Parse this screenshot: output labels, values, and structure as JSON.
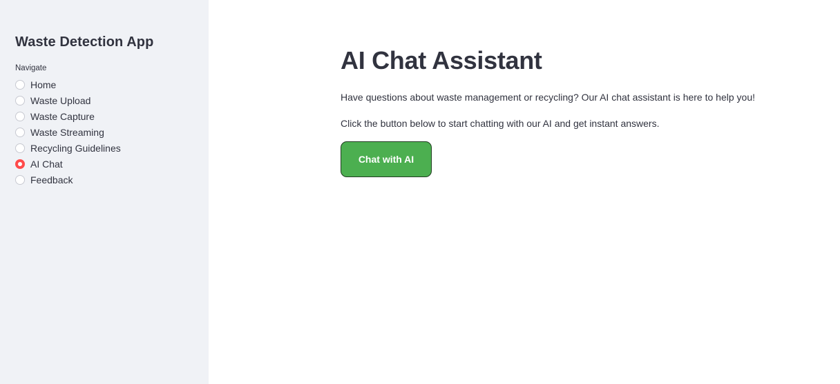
{
  "sidebar": {
    "title": "Waste Detection App",
    "nav_label": "Navigate",
    "items": [
      {
        "label": "Home",
        "selected": false
      },
      {
        "label": "Waste Upload",
        "selected": false
      },
      {
        "label": "Waste Capture",
        "selected": false
      },
      {
        "label": "Waste Streaming",
        "selected": false
      },
      {
        "label": "Recycling Guidelines",
        "selected": false
      },
      {
        "label": "AI Chat",
        "selected": true
      },
      {
        "label": "Feedback",
        "selected": false
      }
    ]
  },
  "main": {
    "title": "AI Chat Assistant",
    "paragraph1": "Have questions about waste management or recycling? Our AI chat assistant is here to help you!",
    "paragraph2": "Click the button below to start chatting with our AI and get instant answers.",
    "button_label": "Chat with AI"
  },
  "colors": {
    "sidebar_bg": "#f0f2f6",
    "accent": "#ff4b4b",
    "button_bg": "#4caf50",
    "text": "#31333f"
  }
}
